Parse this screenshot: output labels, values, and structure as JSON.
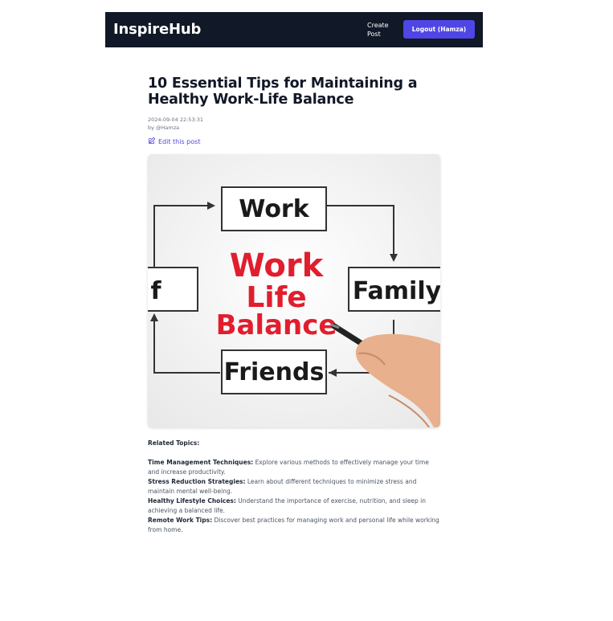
{
  "navbar": {
    "brand": "InspireHub",
    "create_post": "Create Post",
    "logout": "Logout (Hamza)"
  },
  "post": {
    "title": "10 Essential Tips for Maintaining a Healthy Work-Life Balance",
    "date": "2024-09-04 22:53:31",
    "author": "by @Hamza",
    "edit_label": "Edit this post",
    "image": {
      "box_work": "Work",
      "center_line1": "Work",
      "center_line2": "Life",
      "center_line3": "Balance",
      "box_family": "Family",
      "box_friends": "Friends",
      "box_self": "f"
    },
    "related_heading": "Related Topics:",
    "topics": [
      {
        "name": "Time Management Techniques:",
        "text": " Explore various methods to effectively manage your time and increase productivity."
      },
      {
        "name": "Stress Reduction Strategies:",
        "text": " Learn about different techniques to minimize stress and maintain mental well-being."
      },
      {
        "name": "Healthy Lifestyle Choices:",
        "text": " Understand the importance of exercise, nutrition, and sleep in achieving a balanced life."
      },
      {
        "name": "Remote Work Tips:",
        "text": " Discover best practices for managing work and personal life while working from home."
      }
    ]
  },
  "colors": {
    "navbar_bg": "#111827",
    "accent": "#4f46e5",
    "image_red": "#e11d2e"
  },
  "icons": {
    "edit": "pencil-square-icon"
  }
}
